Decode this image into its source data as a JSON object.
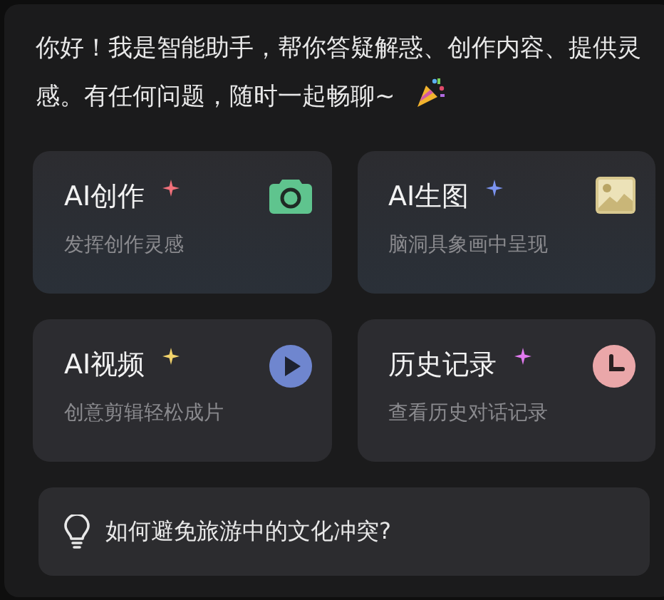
{
  "greeting": "你好！我是智能助手，帮你答疑解惑、创作内容、提供灵感。有任何问题，随时一起畅聊~",
  "cards": [
    {
      "title": "AI创作",
      "subtitle": "发挥创作灵感",
      "color": "#f0707a"
    },
    {
      "title": "AI生图",
      "subtitle": "脑洞具象画中呈现",
      "color": "#7b93f0"
    },
    {
      "title": "AI视频",
      "subtitle": "创意剪辑轻松成片",
      "color": "#f2d36b"
    },
    {
      "title": "历史记录",
      "subtitle": "查看历史对话记录",
      "color": "#e27af0"
    }
  ],
  "suggestion": "如何避免旅游中的文化冲突?"
}
